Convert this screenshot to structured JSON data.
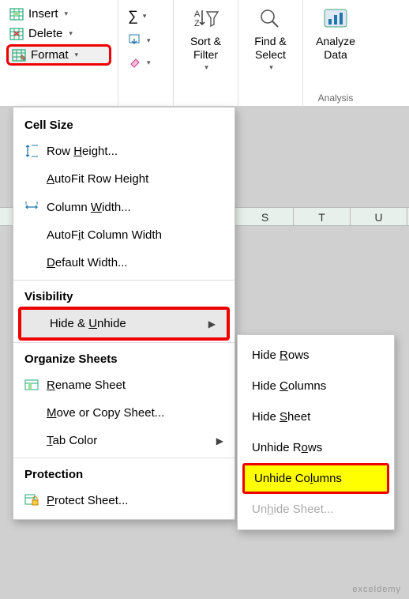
{
  "ribbon": {
    "cells": {
      "insert": "Insert",
      "delete": "Delete",
      "format": "Format"
    },
    "editing": {
      "sort_filter": "Sort & Filter",
      "find_select": "Find & Select"
    },
    "analysis": {
      "analyze_data": "Analyze Data",
      "group_label": "Analysis"
    }
  },
  "columns": [
    "S",
    "T",
    "U"
  ],
  "menu": {
    "cell_size": "Cell Size",
    "row_height": "Row Height...",
    "autofit_row": "AutoFit Row Height",
    "col_width": "Column Width...",
    "autofit_col": "AutoFit Column Width",
    "default_width": "Default Width...",
    "visibility": "Visibility",
    "hide_unhide": "Hide & Unhide",
    "organize": "Organize Sheets",
    "rename": "Rename Sheet",
    "move_copy": "Move or Copy Sheet...",
    "tab_color": "Tab Color",
    "protection": "Protection",
    "protect_sheet": "Protect Sheet..."
  },
  "submenu": {
    "hide_rows": "Hide Rows",
    "hide_cols": "Hide Columns",
    "hide_sheet": "Hide Sheet",
    "unhide_rows": "Unhide Rows",
    "unhide_cols": "Unhide Columns",
    "unhide_sheet": "Unhide Sheet..."
  },
  "watermark": "exceldemy"
}
